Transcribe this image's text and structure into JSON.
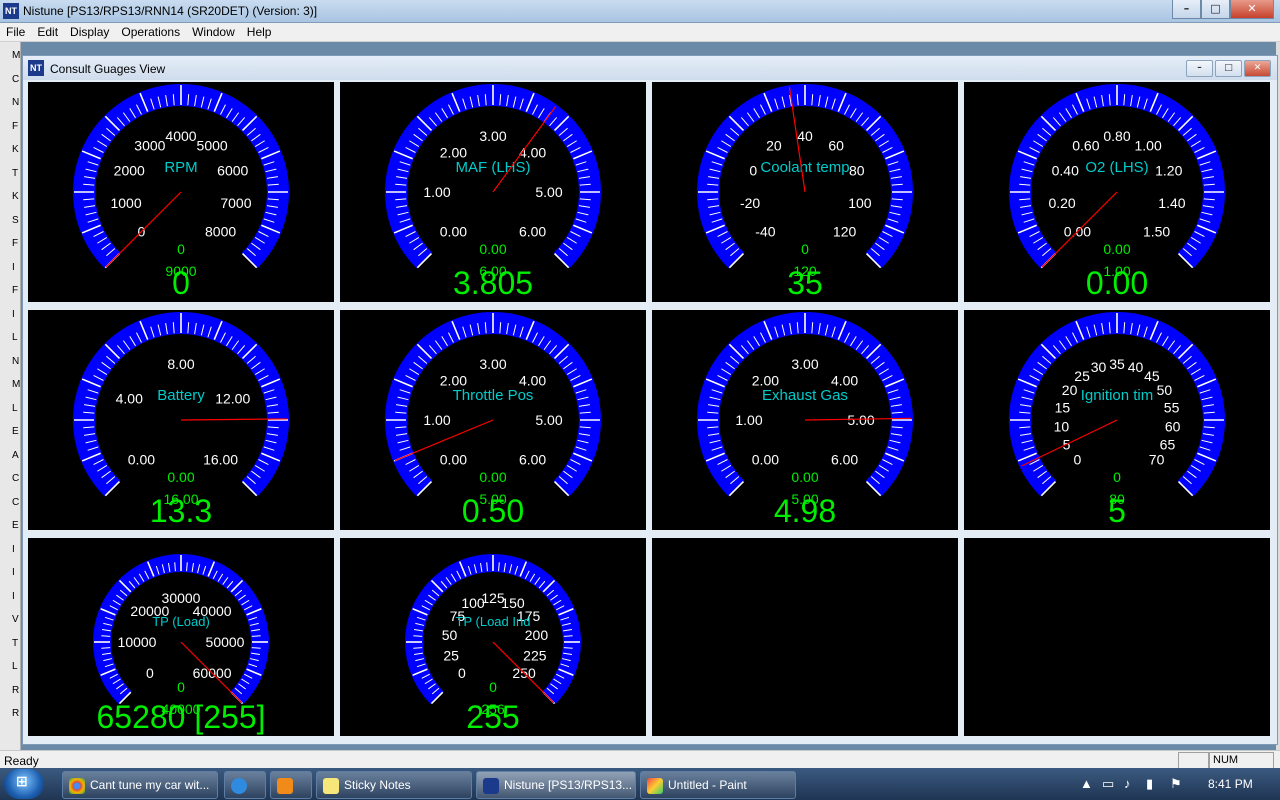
{
  "app": {
    "icon_text": "NT",
    "title": "Nistune [PS13/RPS13/RNN14 (SR20DET) (Version: 3)]",
    "minimize_label": "–",
    "maximize_label": "□",
    "close_label": "✕"
  },
  "menu": [
    "File",
    "Edit",
    "Display",
    "Operations",
    "Window",
    "Help"
  ],
  "left_letters": [
    "M",
    "C",
    "N",
    "F",
    "K",
    "T",
    "K",
    "S",
    "F",
    "I",
    "F",
    "I",
    "L",
    "N",
    "M",
    "L",
    "E",
    "A",
    "C",
    "C",
    "E",
    "I",
    "I",
    "I",
    "V",
    "T",
    "L",
    "R",
    "R"
  ],
  "child_window": {
    "icon_text": "NT",
    "title": "Consult Guages View",
    "min_label": "–",
    "max_label": "□",
    "close_label": "✕"
  },
  "gauges": [
    {
      "name": "RPM",
      "min": 0,
      "max": 9000,
      "ticks": [
        "0",
        "1000",
        "2000",
        "3000",
        "4000",
        "5000",
        "6000",
        "7000",
        "8000"
      ],
      "min_label": "0",
      "max_label": "9000",
      "reading": "0",
      "value": 0,
      "span": [
        0,
        9000
      ]
    },
    {
      "name": "MAF (LHS)",
      "min": 0,
      "max": 6,
      "ticks": [
        "0.00",
        "1.00",
        "2.00",
        "3.00",
        "4.00",
        "5.00",
        "6.00"
      ],
      "min_label": "0.00",
      "max_label": "6.00",
      "reading": "3.805",
      "value": 3.805,
      "span": [
        0,
        6
      ]
    },
    {
      "name": "Coolant temp",
      "min": 0,
      "max": 120,
      "ticks": [
        "-40",
        "-20",
        "0",
        "20",
        "40",
        "60",
        "80",
        "100",
        "120"
      ],
      "min_label": "0",
      "max_label": "120",
      "reading": "35",
      "value": 35,
      "span": [
        -40,
        120
      ]
    },
    {
      "name": "O2 (LHS)",
      "min": 0,
      "max": 1,
      "ticks": [
        "0.00",
        "0.20",
        "0.40",
        "0.60",
        "0.80",
        "1.00",
        "1.20",
        "1.40",
        "1.50"
      ],
      "min_label": "0.00",
      "max_label": "1.00",
      "reading": "0.00",
      "value": 0,
      "span": [
        0,
        1.5
      ]
    },
    {
      "name": "Battery",
      "min": 0,
      "max": 16,
      "ticks": [
        "0.00",
        "4.00",
        "8.00",
        "12.00",
        "16.00"
      ],
      "min_label": "0.00",
      "max_label": "16.00",
      "reading": "13.3",
      "value": 13.3,
      "span": [
        0,
        16
      ]
    },
    {
      "name": "Throttle Pos",
      "min": 0,
      "max": 5,
      "ticks": [
        "0.00",
        "1.00",
        "2.00",
        "3.00",
        "4.00",
        "5.00",
        "6.00"
      ],
      "min_label": "0.00",
      "max_label": "5.00",
      "reading": "0.50",
      "value": 0.5,
      "span": [
        0,
        6
      ]
    },
    {
      "name": "Exhaust Gas",
      "min": 0,
      "max": 5,
      "ticks": [
        "0.00",
        "1.00",
        "2.00",
        "3.00",
        "4.00",
        "5.00",
        "6.00"
      ],
      "min_label": "0.00",
      "max_label": "5.00",
      "reading": "4.98",
      "value": 4.98,
      "span": [
        0,
        6
      ]
    },
    {
      "name": "Ignition tim",
      "min": 0,
      "max": 80,
      "ticks": [
        "0",
        "5",
        "10",
        "15",
        "20",
        "25",
        "30",
        "35",
        "40",
        "45",
        "50",
        "55",
        "60",
        "65",
        "70"
      ],
      "min_label": "0",
      "max_label": "80",
      "reading": "5",
      "value": 5,
      "span": [
        0,
        70
      ]
    },
    {
      "name": "TP (Load)",
      "min": 0,
      "max": 40000,
      "ticks": [
        "0",
        "10000",
        "20000",
        "30000",
        "40000",
        "50000",
        "60000"
      ],
      "min_label": "0",
      "max_label": "40000",
      "reading": "65280 [255]",
      "value": 65280,
      "span": [
        0,
        65280
      ]
    },
    {
      "name": "TP (Load Ind",
      "min": 0,
      "max": 256,
      "ticks": [
        "0",
        "25",
        "50",
        "75",
        "100",
        "125",
        "150",
        "175",
        "200",
        "225",
        "250"
      ],
      "min_label": "0",
      "max_label": "256",
      "reading": "255",
      "value": 255,
      "span": [
        0,
        255
      ]
    }
  ],
  "colors": {
    "arc": "#0000ff",
    "label": "#00cccc",
    "readout": "#00ee00",
    "needle": "#ff0000",
    "panel": "#000000"
  },
  "status": {
    "text": "Ready",
    "num": "NUM"
  },
  "taskbar": {
    "start_label": "⊞",
    "buttons": [
      {
        "label": "Cant tune my car wit...",
        "icon": "chrome-icon"
      },
      {
        "label": "",
        "icon": "ie-icon"
      },
      {
        "label": "",
        "icon": "media-player-icon"
      },
      {
        "label": "Sticky Notes",
        "icon": "sticky-notes-icon"
      },
      {
        "label": "Nistune [PS13/RPS13...",
        "icon": "nistune-icon"
      },
      {
        "label": "Untitled - Paint",
        "icon": "paint-icon"
      }
    ],
    "clock": "8:41 PM"
  }
}
